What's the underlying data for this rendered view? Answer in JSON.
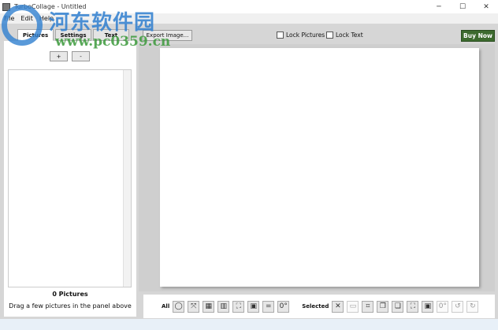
{
  "window": {
    "title": "TurboCollage - Untitled",
    "minimize": "─",
    "maximize": "☐",
    "close": "✕"
  },
  "menu": [
    "File",
    "Edit",
    "Help"
  ],
  "tabs": [
    "Pictures",
    "Settings",
    "Text"
  ],
  "add_label": "+",
  "remove_label": "-",
  "export_label": "Export Image...",
  "lock_pictures": "Lock Pictures",
  "lock_text": "Lock Text",
  "buy_now": "Buy Now",
  "picture_count": "0 Pictures",
  "hint": "Drag a few pictures in the panel above",
  "bottom": {
    "all_label": "All",
    "selected_label": "Selected",
    "all_tools": [
      {
        "name": "shuffle-icon",
        "g": "◯"
      },
      {
        "name": "expand-icon",
        "g": "⤧"
      },
      {
        "name": "grid-icon",
        "g": "▦"
      },
      {
        "name": "layout-icon",
        "g": "▥"
      },
      {
        "name": "fit-icon",
        "g": "⛶"
      },
      {
        "name": "fill-icon",
        "g": "▣"
      },
      {
        "name": "align-icon",
        "g": "="
      },
      {
        "name": "rotate-zero-icon",
        "g": "0°"
      }
    ],
    "selected_tools": [
      {
        "name": "delete-icon",
        "g": "✕"
      },
      {
        "name": "image-icon",
        "g": "▭"
      },
      {
        "name": "crop-icon",
        "g": "⌗"
      },
      {
        "name": "bring-front-icon",
        "g": "❐"
      },
      {
        "name": "send-back-icon",
        "g": "❏"
      },
      {
        "name": "fit-icon",
        "g": "⛶"
      },
      {
        "name": "fill-icon",
        "g": "▣"
      },
      {
        "name": "rotate-zero-icon",
        "g": "0°"
      },
      {
        "name": "rotate-left-icon",
        "g": "↺"
      },
      {
        "name": "rotate-right-icon",
        "g": "↻"
      }
    ]
  },
  "watermark": {
    "cn": "河东软件园",
    "url": "www.pc0359.cn"
  },
  "colors": {
    "buy": "#3c6a2e"
  }
}
